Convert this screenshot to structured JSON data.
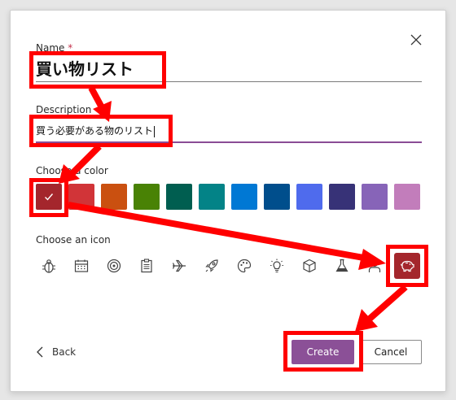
{
  "dialog": {
    "name_label": "Name",
    "required_mark": "*",
    "name_value": "買い物リスト",
    "description_label": "Description",
    "description_value": "買う必要がある物のリスト",
    "color_label": "Choose a color",
    "icon_label": "Choose an icon",
    "back_label": "Back",
    "create_label": "Create",
    "cancel_label": "Cancel"
  },
  "colors": [
    {
      "name": "dark-red",
      "hex": "#a4262c",
      "selected": true
    },
    {
      "name": "red",
      "hex": "#d13438",
      "selected": false
    },
    {
      "name": "orange",
      "hex": "#ca5010",
      "selected": false
    },
    {
      "name": "green",
      "hex": "#498205",
      "selected": false
    },
    {
      "name": "dark-teal",
      "hex": "#005e50",
      "selected": false
    },
    {
      "name": "teal",
      "hex": "#038387",
      "selected": false
    },
    {
      "name": "blue",
      "hex": "#0078d4",
      "selected": false
    },
    {
      "name": "dark-blue",
      "hex": "#004e8c",
      "selected": false
    },
    {
      "name": "periwinkle",
      "hex": "#4f6bed",
      "selected": false
    },
    {
      "name": "indigo",
      "hex": "#373277",
      "selected": false
    },
    {
      "name": "purple",
      "hex": "#8764b8",
      "selected": false
    },
    {
      "name": "pink-purple",
      "hex": "#c27dbb",
      "selected": false
    }
  ],
  "icons": [
    "bug-icon",
    "calendar-icon",
    "target-icon",
    "clipboard-icon",
    "airplane-icon",
    "rocket-icon",
    "palette-icon",
    "lightbulb-icon",
    "cube-icon",
    "flask-icon",
    "person-icon",
    "piggy-bank-icon"
  ],
  "selected_icon": "piggy-bank-icon",
  "accent_color": "#8b5097",
  "annotation_color": "#ff0000"
}
